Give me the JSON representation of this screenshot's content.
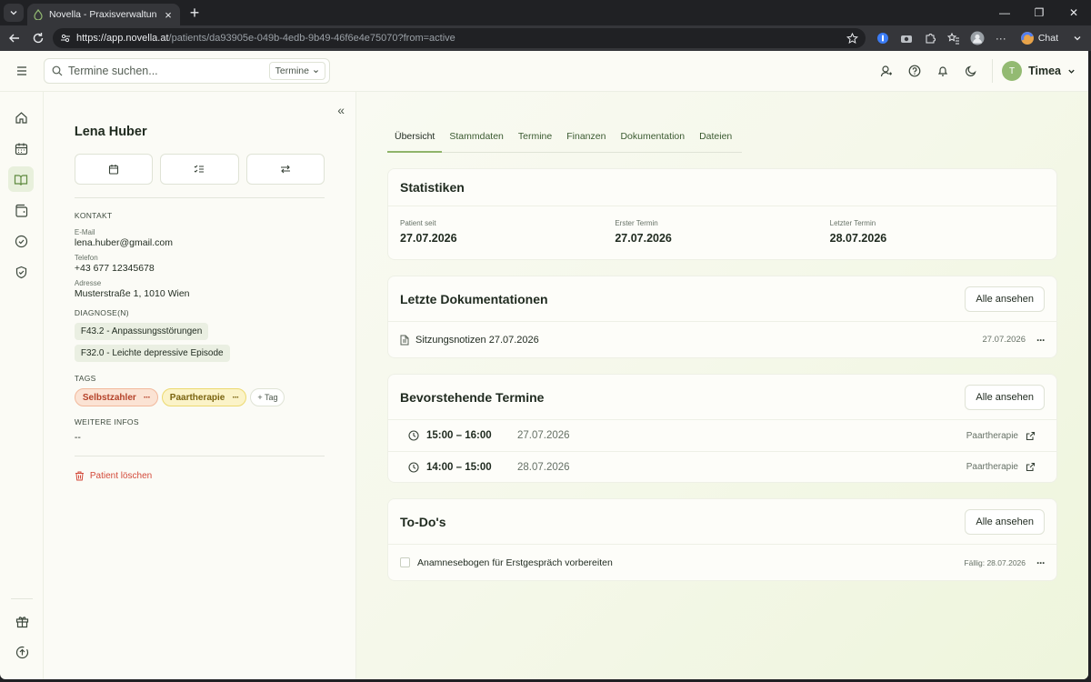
{
  "browser": {
    "tab_title": "Novella - Praxisverwaltung für The",
    "url_host": "https://app.novella.at",
    "url_path": "/patients/da93905e-049b-4edb-9b49-46f6e4e75070?from=active",
    "chat_label": "Chat"
  },
  "topbar": {
    "search_placeholder": "Termine suchen...",
    "search_scope": "Termine",
    "user_initial": "T",
    "user_name": "Timea"
  },
  "patient": {
    "name": "Lena Huber",
    "contact_title": "KONTAKT",
    "email_label": "E-Mail",
    "email": "lena.huber@gmail.com",
    "phone_label": "Telefon",
    "phone": "+43 677 12345678",
    "address_label": "Adresse",
    "address": "Musterstraße 1, 1010 Wien",
    "diagnoses_title": "DIAGNOSE(N)",
    "diagnoses": [
      "F43.2 - Anpassungsstörungen",
      "F32.0 - Leichte depressive Episode"
    ],
    "tags_title": "TAGS",
    "tags": [
      {
        "label": "Selbstzahler",
        "color": "#b5432a"
      },
      {
        "label": "Paartherapie",
        "color": "#7a6410"
      }
    ],
    "add_tag": "+ Tag",
    "more_title": "WEITERE INFOS",
    "more_value": "--",
    "delete_label": "Patient löschen"
  },
  "tabs": [
    "Übersicht",
    "Stammdaten",
    "Termine",
    "Finanzen",
    "Dokumentation",
    "Dateien"
  ],
  "stats": {
    "title": "Statistiken",
    "items": [
      {
        "label": "Patient seit",
        "value": "27.07.2026"
      },
      {
        "label": "Erster Termin",
        "value": "27.07.2026"
      },
      {
        "label": "Letzter Termin",
        "value": "28.07.2026"
      }
    ]
  },
  "docs": {
    "title": "Letzte Dokumentationen",
    "all_label": "Alle ansehen",
    "items": [
      {
        "name": "Sitzungsnotizen 27.07.2026",
        "date": "27.07.2026"
      }
    ]
  },
  "appointments": {
    "title": "Bevorstehende Termine",
    "all_label": "Alle ansehen",
    "items": [
      {
        "time": "15:00 – 16:00",
        "date": "27.07.2026",
        "type": "Paartherapie"
      },
      {
        "time": "14:00 – 15:00",
        "date": "28.07.2026",
        "type": "Paartherapie"
      }
    ]
  },
  "todos": {
    "title": "To-Do's",
    "all_label": "Alle ansehen",
    "items": [
      {
        "text": "Anamnesebogen für Erstgespräch vorbereiten",
        "due": "Fällig: 28.07.2026"
      }
    ]
  },
  "colors": {
    "accent": "#8fb46a",
    "danger": "#d34a3a"
  }
}
